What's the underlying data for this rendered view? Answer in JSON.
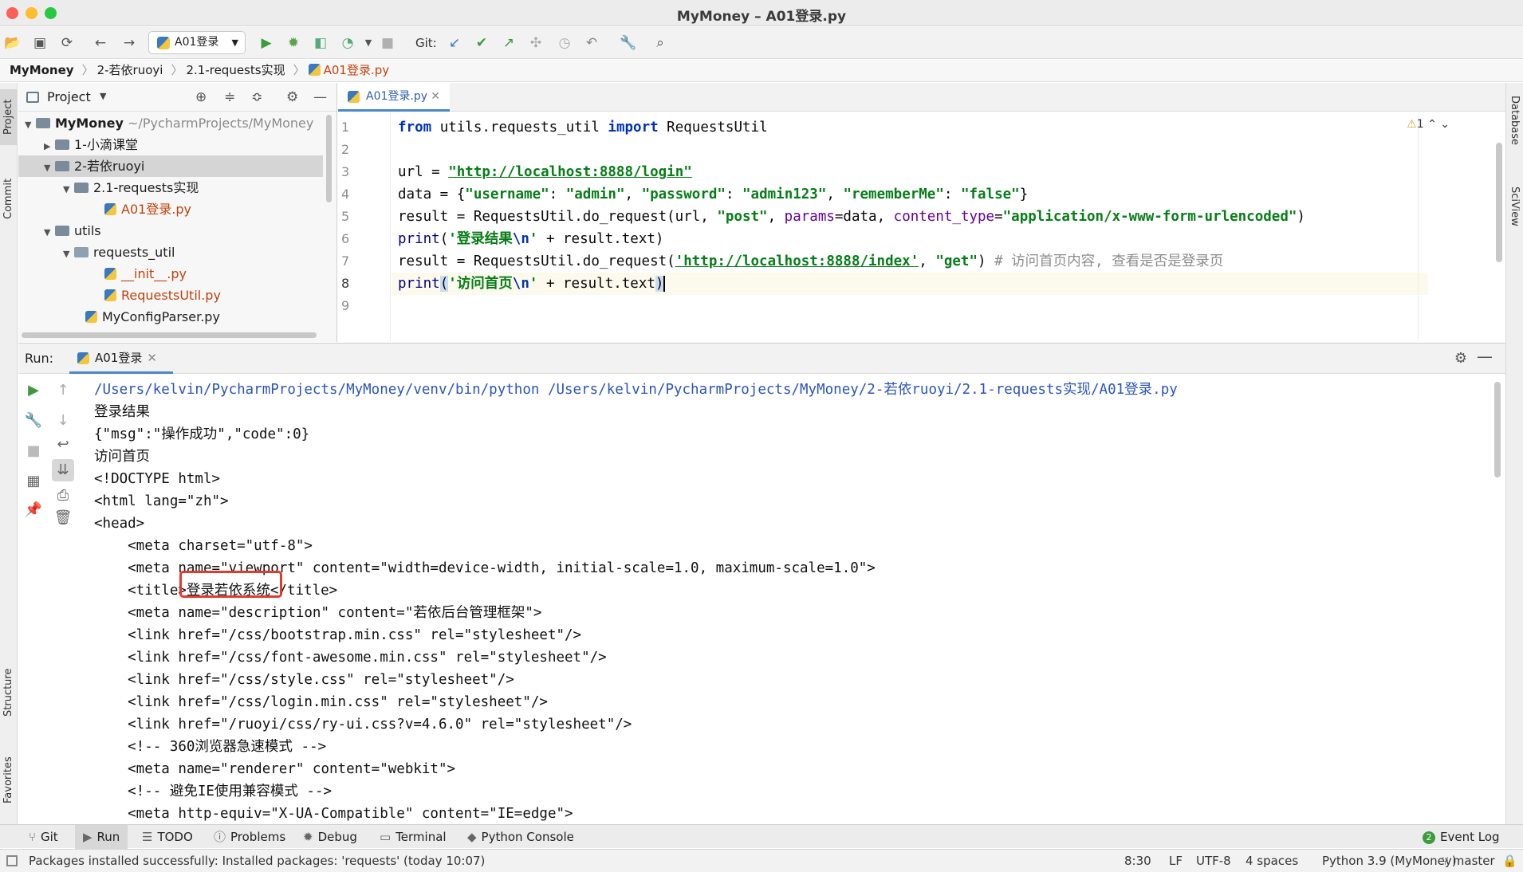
{
  "window": {
    "title": "MyMoney – A01登录.py"
  },
  "toolbar": {
    "run_config": "A01登录",
    "git_label": "Git:"
  },
  "breadcrumb": [
    "MyMoney",
    "2-若依ruoyi",
    "2.1-requests实现",
    "A01登录.py"
  ],
  "left_tabs": {
    "project": "Project",
    "commit": "Commit",
    "structure": "Structure",
    "favorites": "Favorites"
  },
  "right_tabs": {
    "database": "Database",
    "sciview": "SciView"
  },
  "project": {
    "title": "Project",
    "tree": [
      {
        "label": "MyMoney",
        "path": "~/PycharmProjects/MyMoney"
      },
      {
        "label": "1-小滴课堂"
      },
      {
        "label": "2-若依ruoyi"
      },
      {
        "label": "2.1-requests实现"
      },
      {
        "label": "A01登录.py"
      },
      {
        "label": "utils"
      },
      {
        "label": "requests_util"
      },
      {
        "label": "__init__.py"
      },
      {
        "label": "RequestsUtil.py"
      },
      {
        "label": "MyConfigParser.py"
      }
    ]
  },
  "editor": {
    "tab": "A01登录.py",
    "warnings": "1",
    "lines": [
      "1",
      "2",
      "3",
      "4",
      "5",
      "6",
      "7",
      "8",
      "9"
    ]
  },
  "run": {
    "label": "Run:",
    "tab": "A01登录",
    "console": [
      "/Users/kelvin/PycharmProjects/MyMoney/venv/bin/python /Users/kelvin/PycharmProjects/MyMoney/2-若依ruoyi/2.1-requests实现/A01登录.py",
      "登录结果",
      "{\"msg\":\"操作成功\",\"code\":0}",
      "访问首页",
      "<!DOCTYPE html>",
      "<html lang=\"zh\">",
      "<head>",
      "    <meta charset=\"utf-8\">",
      "    <meta name=\"viewport\" content=\"width=device-width, initial-scale=1.0, maximum-scale=1.0\">",
      "    <title>登录若依系统</title>",
      "    <meta name=\"description\" content=\"若依后台管理框架\">",
      "    <link href=\"/css/bootstrap.min.css\" rel=\"stylesheet\"/>",
      "    <link href=\"/css/font-awesome.min.css\" rel=\"stylesheet\"/>",
      "    <link href=\"/css/style.css\" rel=\"stylesheet\"/>",
      "    <link href=\"/css/login.min.css\" rel=\"stylesheet\"/>",
      "    <link href=\"/ruoyi/css/ry-ui.css?v=4.6.0\" rel=\"stylesheet\"/>",
      "    <!-- 360浏览器急速模式 -->",
      "    <meta name=\"renderer\" content=\"webkit\">",
      "    <!-- 避免IE使用兼容模式 -->",
      "    <meta http-equiv=\"X-UA-Compatible\" content=\"IE=edge\">"
    ]
  },
  "bottom_tools": [
    "Git",
    "Run",
    "TODO",
    "Problems",
    "Debug",
    "Terminal",
    "Python Console",
    "Event Log"
  ],
  "event_log_count": "2",
  "status": {
    "message": "Packages installed successfully: Installed packages: 'requests' (today 10:07)",
    "position": "8:30",
    "line_sep": "LF",
    "encoding": "UTF-8",
    "indent": "4 spaces",
    "interpreter": "Python 3.9 (MyMoney)",
    "branch": "master"
  },
  "colors": {
    "accent": "#4a88c7",
    "highlight_box": "#e23b2e",
    "string": "#067d17",
    "keyword": "#0033b3"
  }
}
